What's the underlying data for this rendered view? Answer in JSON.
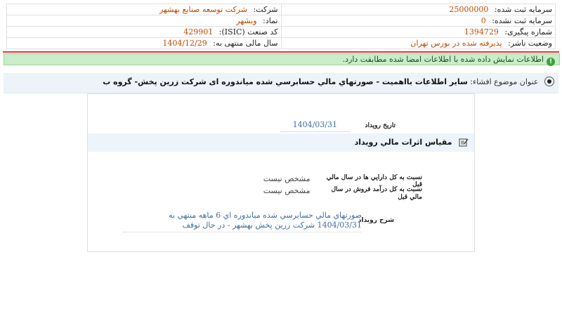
{
  "company_info": {
    "company_label": "شرکت:",
    "company_value": "شرکت توسعه صنایع بهشهر",
    "registered_capital_label": "سرمایه ثبت شده:",
    "registered_capital_value": "25000000",
    "symbol_label": "نماد:",
    "symbol_value": "وبشهر",
    "unregistered_capital_label": "سرمایه ثبت نشده:",
    "unregistered_capital_value": "0",
    "isic_label": "کد صنعت (ISIC):",
    "isic_value": "429901",
    "tracking_label": "شماره پیگیری:",
    "tracking_value": "1394729",
    "fiscal_year_label": "سال مالی منتهی به:",
    "fiscal_year_value": "1404/12/29",
    "publisher_status_label": "وضعیت ناشر:",
    "publisher_status_value": "پذیرفته شده در بورس تهران"
  },
  "notice": {
    "text": "اطلاعات نمایش داده شده با اطلاعات امضا شده مطابقت دارد."
  },
  "subject": {
    "label": "عنوان موضوع افشاء:",
    "title": "ساير اطلاعات بااهميت - صورتهاي مالي حسابرسي شده مياندوره ای شرکت زرين پخش- گروه ب"
  },
  "details": {
    "event_date_label": "تاريخ رويداد",
    "event_date_value": "1404/03/31",
    "section_title": "مقياس اثرات مالي رويداد",
    "assets_ratio_label": "نسبت به کل دارايي ها در سال مالي قبل",
    "assets_ratio_value": "مشخص نيست",
    "sales_ratio_label": "نسبت به کل درآمد فروش در سال مالي قبل",
    "sales_ratio_value": "مشخص نيست",
    "description_label": "شرح رويداد",
    "description_value": "صورتهاي مالي حسابرسي شده مياندوره اي 6 ماهه منتهي به 1404/03/31 شرکت زرين پخش بهشهر - در حال توقف"
  }
}
